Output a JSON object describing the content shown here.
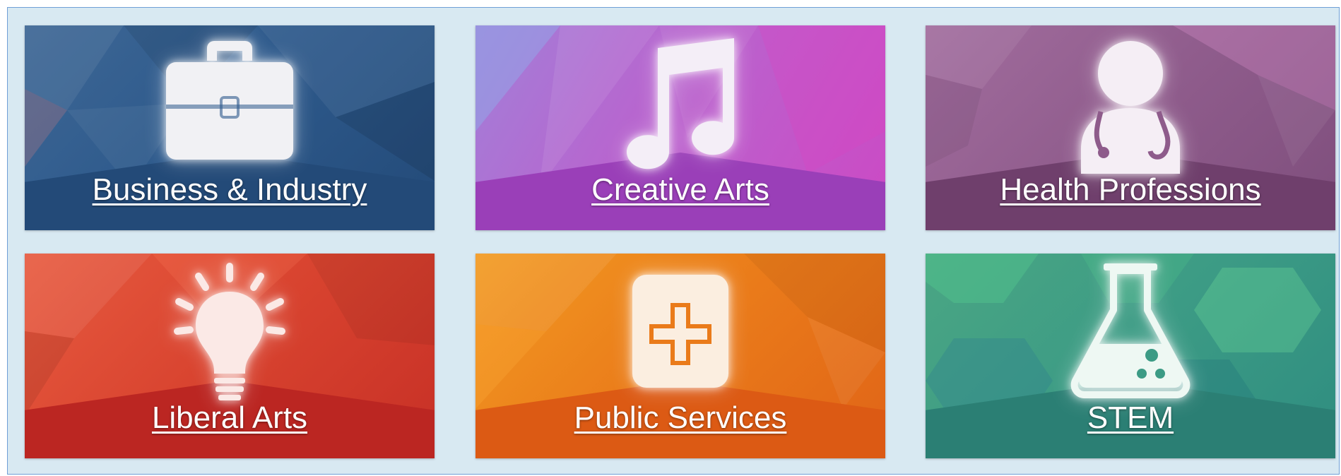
{
  "tiles": [
    {
      "id": "business",
      "label": "Business & Industry",
      "icon": "briefcase-icon",
      "color": "#2e5a8c"
    },
    {
      "id": "creative",
      "label": "Creative Arts",
      "icon": "music-note-icon",
      "color": "#b04fc8"
    },
    {
      "id": "health",
      "label": "Health Professions",
      "icon": "doctor-icon",
      "color": "#8e5b8b"
    },
    {
      "id": "liberal",
      "label": "Liberal Arts",
      "icon": "lightbulb-icon",
      "color": "#d8432f"
    },
    {
      "id": "public",
      "label": "Public Services",
      "icon": "first-aid-icon",
      "color": "#ea7b1a"
    },
    {
      "id": "stem",
      "label": "STEM",
      "icon": "flask-icon",
      "color": "#3c9b85"
    }
  ]
}
